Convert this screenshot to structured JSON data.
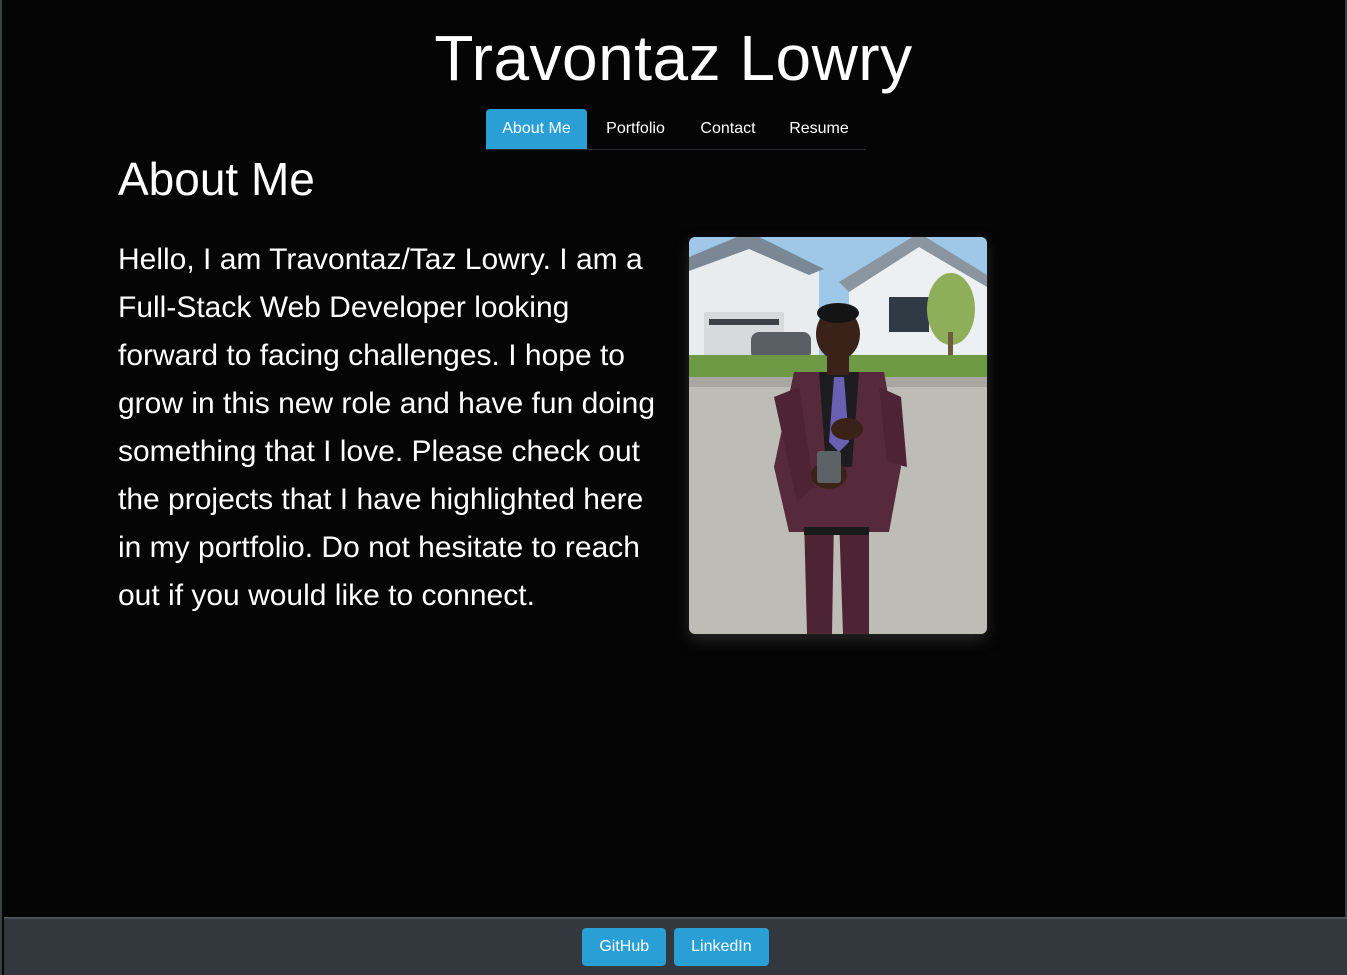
{
  "header": {
    "title": "Travontaz Lowry"
  },
  "nav": {
    "tabs": [
      {
        "label": "About Me",
        "active": true
      },
      {
        "label": "Portfolio",
        "active": false
      },
      {
        "label": "Contact",
        "active": false
      },
      {
        "label": "Resume",
        "active": false
      }
    ]
  },
  "main": {
    "heading": "About Me",
    "bio": "Hello, I am Travontaz/Taz Lowry. I am a Full-Stack Web Developer looking forward to facing challenges. I hope to grow in this new role and have fun doing something that I love. Please check out the projects that I have highlighted here in my portfolio. Do not hesitate to reach out if you would like to connect."
  },
  "footer": {
    "github_label": "GitHub",
    "linkedin_label": "LinkedIn"
  },
  "colors": {
    "accent": "#2a9fd6",
    "background": "#050505",
    "footer_bg": "#32383e"
  }
}
